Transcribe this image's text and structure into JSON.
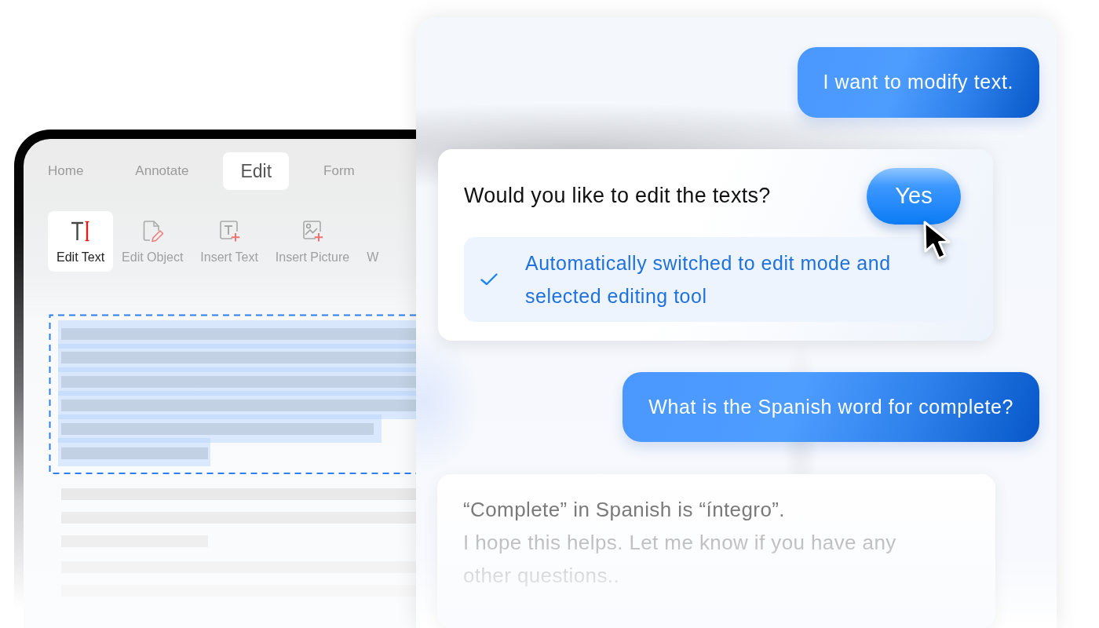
{
  "editor": {
    "tabs": [
      {
        "label": "Home",
        "selected": false
      },
      {
        "label": "Annotate",
        "selected": false
      },
      {
        "label": "Edit",
        "selected": true
      },
      {
        "label": "Form",
        "selected": false
      }
    ],
    "tools": [
      {
        "label": "Edit Text",
        "kind": "edit-text",
        "selected": true
      },
      {
        "label": "Edit Object",
        "kind": "edit-object",
        "selected": false
      },
      {
        "label": "Insert Text",
        "kind": "insert-text",
        "selected": false
      },
      {
        "label": "Insert Picture",
        "kind": "insert-picture",
        "selected": false
      },
      {
        "label": "W",
        "kind": "covered",
        "selected": false
      }
    ]
  },
  "chat": {
    "messages": [
      {
        "kind": "user",
        "text": "I want to modify text."
      },
      {
        "kind": "prompt",
        "question": "Would you like to edit the texts?",
        "button": "Yes",
        "notice": "Automatically switched to edit mode and selected editing tool"
      },
      {
        "kind": "user",
        "text": "What is the Spanish word for complete?"
      },
      {
        "kind": "reply",
        "paragraphs": [
          "“Complete” in Spanish is “íntegro”.",
          "I hope this helps. Let me know if you have any other questions.."
        ]
      }
    ]
  }
}
